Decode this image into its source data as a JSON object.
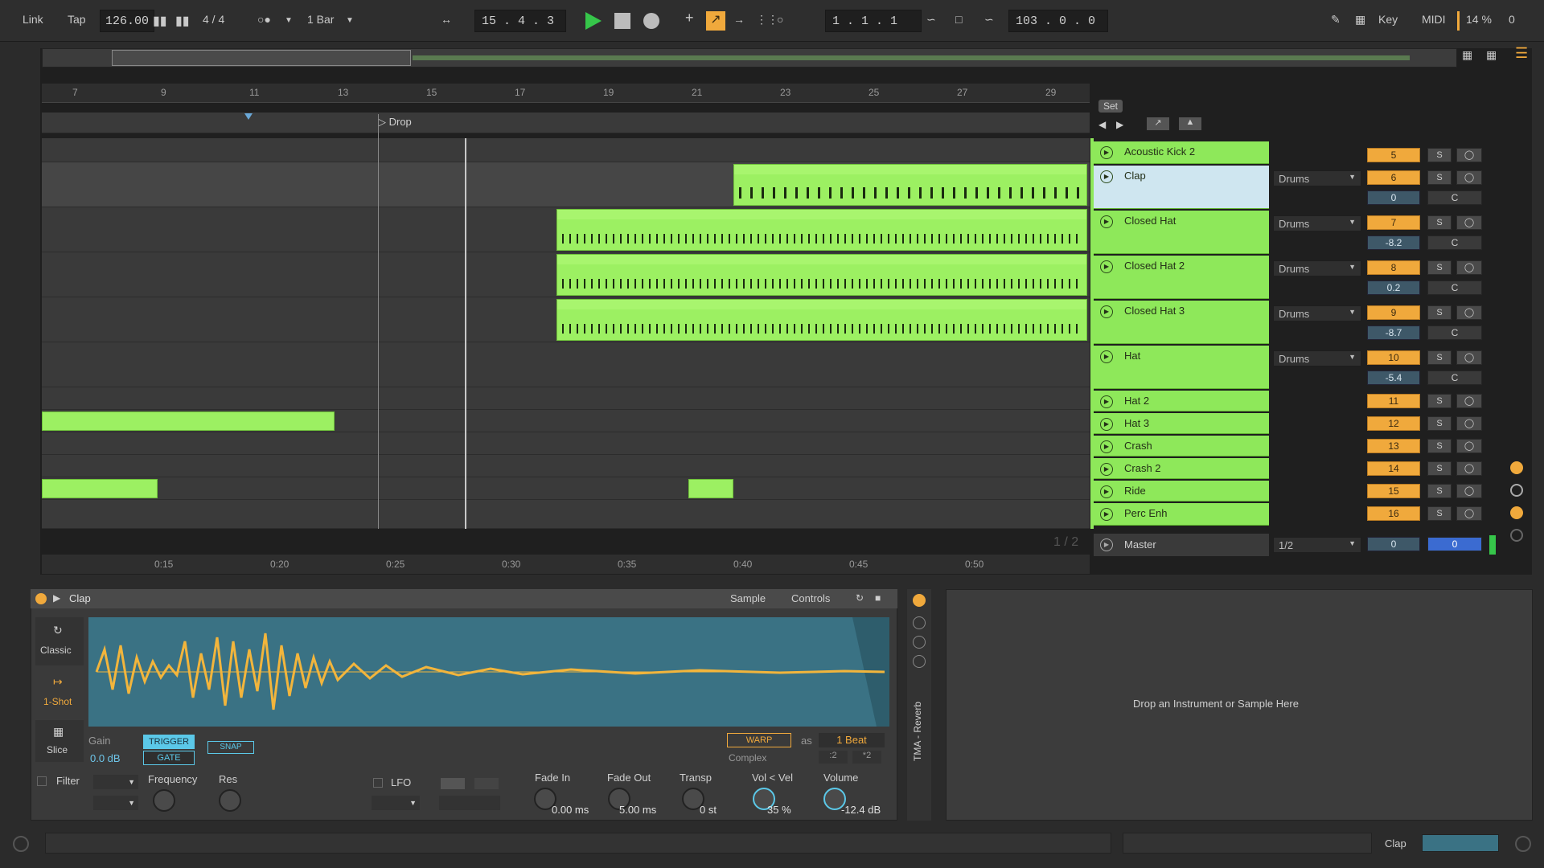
{
  "transport": {
    "link": "Link",
    "tap": "Tap",
    "tempo": "126.00",
    "signature": "4 / 4",
    "quantize": "1 Bar",
    "position": "15 .  4 .  3",
    "loop_start": "1 .  1 .  1",
    "loop_length": "103 .  0 .  0",
    "key": "Key",
    "midi": "MIDI",
    "cpu": "14 %",
    "cpu_extra": "0"
  },
  "ruler": {
    "bars": [
      "7",
      "9",
      "11",
      "13",
      "15",
      "17",
      "19",
      "21",
      "23",
      "25",
      "27",
      "29"
    ],
    "locator": "Drop",
    "set_button": "Set"
  },
  "time_ruler": [
    "0:15",
    "0:20",
    "0:25",
    "0:30",
    "0:35",
    "0:40",
    "0:45",
    "0:50"
  ],
  "tracks": [
    {
      "name": "Acoustic Kick 2",
      "route": "",
      "num": "5",
      "vol": "",
      "pan": ""
    },
    {
      "name": "Clap",
      "route": "Drums",
      "num": "6",
      "vol": "0",
      "pan": "C"
    },
    {
      "name": "Closed Hat",
      "route": "Drums",
      "num": "7",
      "vol": "-8.2",
      "pan": "C"
    },
    {
      "name": "Closed Hat 2",
      "route": "Drums",
      "num": "8",
      "vol": "0.2",
      "pan": "C"
    },
    {
      "name": "Closed Hat 3",
      "route": "Drums",
      "num": "9",
      "vol": "-8.7",
      "pan": "C"
    },
    {
      "name": "Hat",
      "route": "Drums",
      "num": "10",
      "vol": "-5.4",
      "pan": "C"
    },
    {
      "name": "Hat 2",
      "route": "",
      "num": "11",
      "vol": "",
      "pan": ""
    },
    {
      "name": "Hat 3",
      "route": "",
      "num": "12",
      "vol": "",
      "pan": ""
    },
    {
      "name": "Crash",
      "route": "",
      "num": "13",
      "vol": "",
      "pan": ""
    },
    {
      "name": "Crash 2",
      "route": "",
      "num": "14",
      "vol": "",
      "pan": ""
    },
    {
      "name": "Ride",
      "route": "",
      "num": "15",
      "vol": "",
      "pan": ""
    },
    {
      "name": "Perc Enh",
      "route": "",
      "num": "16",
      "vol": "",
      "pan": ""
    }
  ],
  "master": {
    "name": "Master",
    "route": "1/2",
    "page": "1 / 2",
    "vol": "0",
    "vol2": "0"
  },
  "solo_label": "S",
  "device": {
    "title": "Clap",
    "tab_sample": "Sample",
    "tab_controls": "Controls",
    "mode_classic": "Classic",
    "mode_oneshot": "1-Shot",
    "mode_slice": "Slice",
    "gain_label": "Gain",
    "gain_value": "0.0 dB",
    "trigger": "TRIGGER",
    "gate": "GATE",
    "snap": "SNAP",
    "warp": "WARP",
    "as": "as",
    "beat": "1 Beat",
    "complex": "Complex",
    "filter": "Filter",
    "frequency": "Frequency",
    "res": "Res",
    "lfo": "LFO",
    "fade_in_label": "Fade In",
    "fade_in_value": "0.00 ms",
    "fade_out_label": "Fade Out",
    "fade_out_value": "5.00 ms",
    "transp_label": "Transp",
    "transp_value": "0 st",
    "vel_label": "Vol < Vel",
    "vel_value": "35 %",
    "volume_label": "Volume",
    "volume_value": "-12.4 dB",
    "side_title": "TMA - Reverb"
  },
  "dropzone": "Drop an Instrument or Sample Here",
  "status": {
    "clip": "Clap"
  },
  "colors": {
    "clip_green": "#9cf062",
    "track_orange": "#f0a93c",
    "wave_bg": "#3a7284",
    "wave_fg": "#f2b53c"
  }
}
